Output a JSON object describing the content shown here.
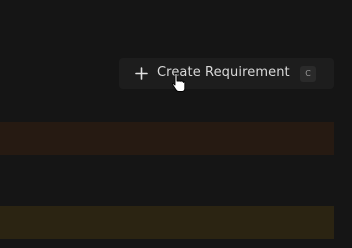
{
  "toolbar": {
    "create_label": "Create Requirement",
    "shortcut_key": "C",
    "icon": "plus-icon"
  },
  "colors": {
    "background": "#151515",
    "button_bg": "#1d1d1d",
    "row_highlight_1": "#261a12",
    "row_highlight_2": "#2b2412"
  }
}
